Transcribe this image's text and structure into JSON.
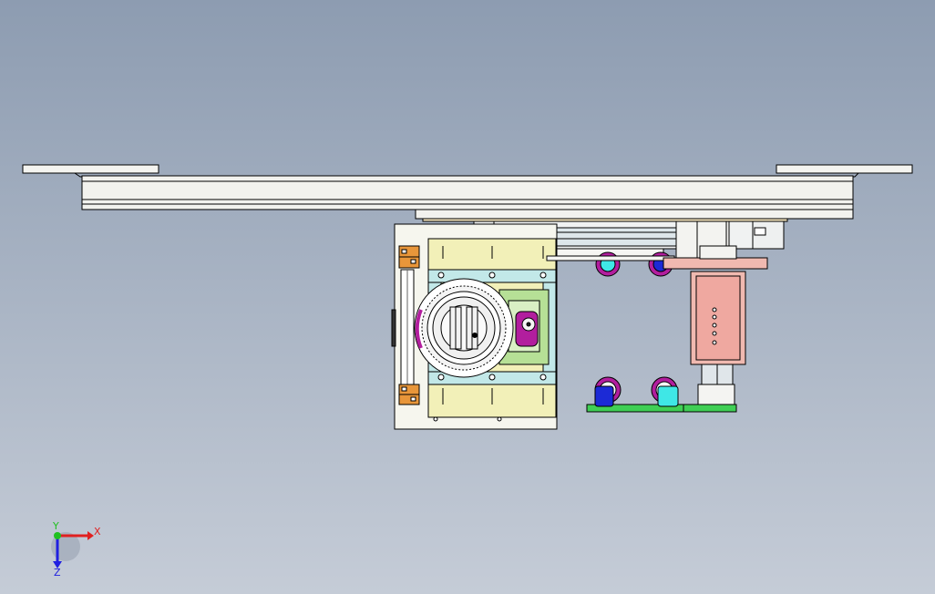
{
  "viewport": {
    "background_top": "#8d9cb1",
    "background_bottom": "#c5ccd7"
  },
  "colors": {
    "outline": "#000000",
    "rail": "#f2f2ee",
    "plate": "#f6f6ee",
    "bracket_yellow": "#f2f0b8",
    "mount_cyan": "#c2e8e8",
    "block_green": "#b6e096",
    "pocket_magenta": "#b21e9e",
    "pcb_green": "#3fcf55",
    "carriage_pink": "#f0b9b0",
    "cap_blue": "#1c2ad6",
    "cap_cyan": "#3fe7e6",
    "terminal_orange": "#e8963a"
  },
  "triad": {
    "x_label": "X",
    "y_label": "Y",
    "z_label": "Z",
    "x_color": "#e02020",
    "y_color": "#20c020",
    "z_color": "#2020e0"
  }
}
